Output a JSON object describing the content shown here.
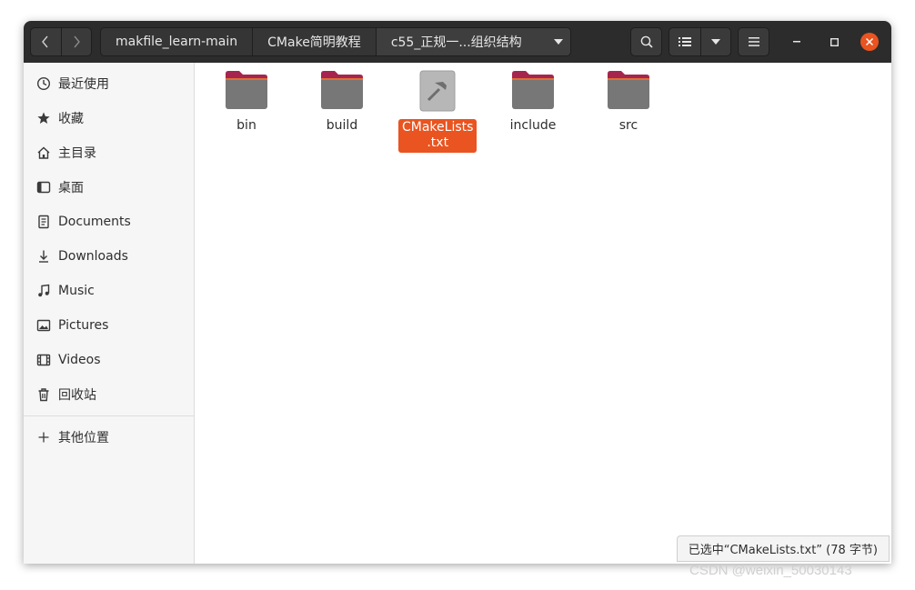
{
  "headerbar": {
    "path": [
      "makfile_learn-main",
      "CMake简明教程",
      "c55_正规一...组织结构"
    ]
  },
  "sidebar": {
    "items": [
      {
        "label": "最近使用",
        "icon": "clock-icon"
      },
      {
        "label": "收藏",
        "icon": "star-icon"
      },
      {
        "label": "主目录",
        "icon": "home-icon"
      },
      {
        "label": "桌面",
        "icon": "desktop-icon"
      },
      {
        "label": "Documents",
        "icon": "document-icon"
      },
      {
        "label": "Downloads",
        "icon": "download-icon"
      },
      {
        "label": "Music",
        "icon": "music-icon"
      },
      {
        "label": "Pictures",
        "icon": "picture-icon"
      },
      {
        "label": "Videos",
        "icon": "video-icon"
      },
      {
        "label": "回收站",
        "icon": "trash-icon"
      }
    ],
    "other_locations": {
      "label": "其他位置",
      "icon": "plus-icon"
    }
  },
  "files": [
    {
      "name": "bin",
      "type": "folder"
    },
    {
      "name": "build",
      "type": "folder"
    },
    {
      "name_line1": "CMakeLists",
      "name_line2": ".txt",
      "type": "cmake-file",
      "selected": true
    },
    {
      "name": "include",
      "type": "folder"
    },
    {
      "name": "src",
      "type": "folder"
    }
  ],
  "status": "已选中“CMakeLists.txt” (78 字节)",
  "watermark": "CSDN @weixin_50030143",
  "colors": {
    "accent": "#e95420",
    "headerbar": "#2c2c2c",
    "folder_top": "#a5254f",
    "folder_body": "#777777",
    "close_button": "#e95420"
  }
}
